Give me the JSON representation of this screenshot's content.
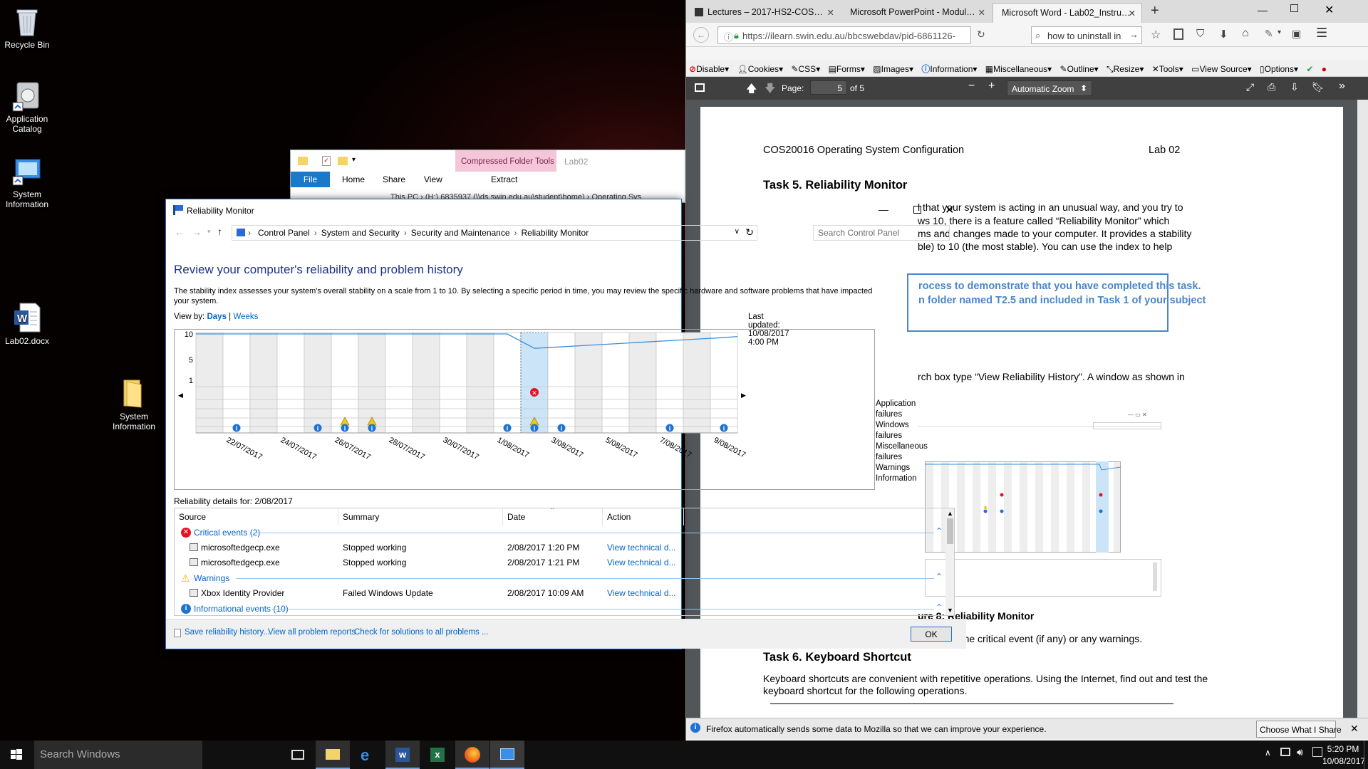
{
  "desktop": {
    "icons": [
      {
        "label": "Recycle Bin"
      },
      {
        "label": "Application Catalog"
      },
      {
        "label": "System Information"
      },
      {
        "label": "Lab02.docx"
      },
      {
        "label": "System Information"
      }
    ]
  },
  "firefox": {
    "tabs": [
      {
        "label": "Lectures – 2017-HS2-COS…"
      },
      {
        "label": "Microsoft PowerPoint - Modul…"
      },
      {
        "label": "Microsoft Word - Lab02_Instru…"
      }
    ],
    "url": "https://ilearn.swin.edu.au/bbcswebdav/pid-6861126-",
    "search_value": "how to uninstall in",
    "devbar": [
      "Disable",
      "Cookies",
      "CSS",
      "Forms",
      "Images",
      "Information",
      "Miscellaneous",
      "Outline",
      "Resize",
      "Tools",
      "View Source",
      "Options"
    ],
    "pdf": {
      "page_label": "Page:",
      "page_value": "5",
      "page_total": "of 5",
      "zoom": "Automatic Zoom"
    },
    "notice": "Firefox automatically sends some data to Mozilla so that we can improve your experience.",
    "notice_button": "Choose What I Share"
  },
  "document": {
    "header_left": "COS20016 Operating System Configuration",
    "header_right": "Lab 02",
    "task5_heading": "Task 5.   Reliability Monitor",
    "p1": [
      "l that your system is acting in an unusual way, and you try to",
      "ws 10, there is a feature called “Reliability Monitor” which",
      "ms and changes made to your computer. It provides a stability",
      "ble) to 10 (the most stable). You can use the index to help"
    ],
    "box": [
      "rocess to demonstrate that you have completed this task.",
      "n folder named T2.5 and included in Task 1 of your subject"
    ],
    "p2": "rch box type “View Reliability History”. A window as shown in",
    "figure_caption": "ure 8: Reliability Monitor",
    "p3": "check for the critical event (if any) or any warnings.",
    "task6_heading": "Task 6.   Keyboard Shortcut",
    "p4": [
      "Keyboard shortcuts are convenient with repetitive operations. Using the Internet, find out and test the",
      "keyboard shortcut for the following operations."
    ]
  },
  "explorer": {
    "context_tab": "Compressed Folder Tools",
    "title": "Lab02",
    "ribbon_tabs": [
      "File",
      "Home",
      "Share",
      "View"
    ],
    "context_subtab": "Extract",
    "path": "This PC  ›  (H:) 6835937 (\\\\ds.swin.edu.au\\student\\home)  ›  Operating Sys"
  },
  "reliability": {
    "title": "Reliability Monitor",
    "breadcrumb": [
      "Control Panel",
      "System and Security",
      "Security and Maintenance",
      "Reliability Monitor"
    ],
    "search_placeholder": "Search Control Panel",
    "heading": "Review your computer's reliability and problem history",
    "description": "The stability index assesses your system's overall stability on a scale from 1 to 10. By selecting a specific period in time, you may review the specific hardware and software problems that have impacted your system.",
    "view_by": "View by:",
    "view_days": "Days",
    "view_sep": "|",
    "view_weeks": "Weeks",
    "last_updated": "Last updated: 10/08/2017 4:00 PM",
    "row_labels": [
      "Application failures",
      "Windows failures",
      "Miscellaneous failures",
      "Warnings",
      "Information"
    ],
    "details_label": "Reliability details for: 2/08/2017",
    "columns": [
      "Source",
      "Summary",
      "Date",
      "Action"
    ],
    "groups": {
      "critical": "Critical events (2)",
      "warnings": "Warnings",
      "informational": "Informational events (10)"
    },
    "events": [
      {
        "source": "microsoftedgecp.exe",
        "summary": "Stopped working",
        "date": "2/08/2017 1:20 PM",
        "action": "View  technical d..."
      },
      {
        "source": "microsoftedgecp.exe",
        "summary": "Stopped working",
        "date": "2/08/2017 1:21 PM",
        "action": "View  technical d..."
      },
      {
        "source": "Xbox Identity Provider",
        "summary": "Failed Windows Update",
        "date": "2/08/2017 10:09 AM",
        "action": "View  technical d..."
      }
    ],
    "bottom_links": [
      "Save reliability history...",
      "View all problem reports",
      "Check for solutions to all problems ..."
    ],
    "ok": "OK"
  },
  "chart_data": {
    "type": "line",
    "title": "",
    "ylim": [
      1,
      10
    ],
    "yticks": [
      "10",
      "5",
      "1"
    ],
    "x_tick_labels": [
      "22/07/2017",
      "24/07/2017",
      "26/07/2017",
      "28/07/2017",
      "30/07/2017",
      "1/08/2017",
      "3/08/2017",
      "5/08/2017",
      "7/08/2017",
      "9/08/2017"
    ],
    "days": [
      "21/07",
      "22/07",
      "23/07",
      "24/07",
      "25/07",
      "26/07",
      "27/07",
      "28/07",
      "29/07",
      "30/07",
      "31/07",
      "1/08",
      "2/08",
      "3/08",
      "4/08",
      "5/08",
      "6/08",
      "7/08",
      "8/08",
      "9/08"
    ],
    "stability_index": [
      10,
      10,
      10,
      10,
      10,
      10,
      10,
      10,
      10,
      10,
      10,
      10,
      7.2,
      7.5,
      7.8,
      8.1,
      8.4,
      8.7,
      9.0,
      9.3
    ],
    "selected_day": "2/08",
    "application_failures": [
      "2/08"
    ],
    "warnings": [
      "26/07",
      "27/07",
      "2/08"
    ],
    "information": [
      "22/07",
      "25/07",
      "26/07",
      "27/07",
      "1/08",
      "2/08",
      "3/08",
      "7/08",
      "9/08"
    ],
    "colors": {
      "line": "#3a8fd8",
      "selected": "#cce4f7",
      "error": "#e81123",
      "warning": "#f2c811",
      "info": "#1e73d2"
    }
  },
  "taskbar": {
    "search_placeholder": "Search Windows",
    "time": "5:20 PM",
    "date": "10/08/2017"
  }
}
